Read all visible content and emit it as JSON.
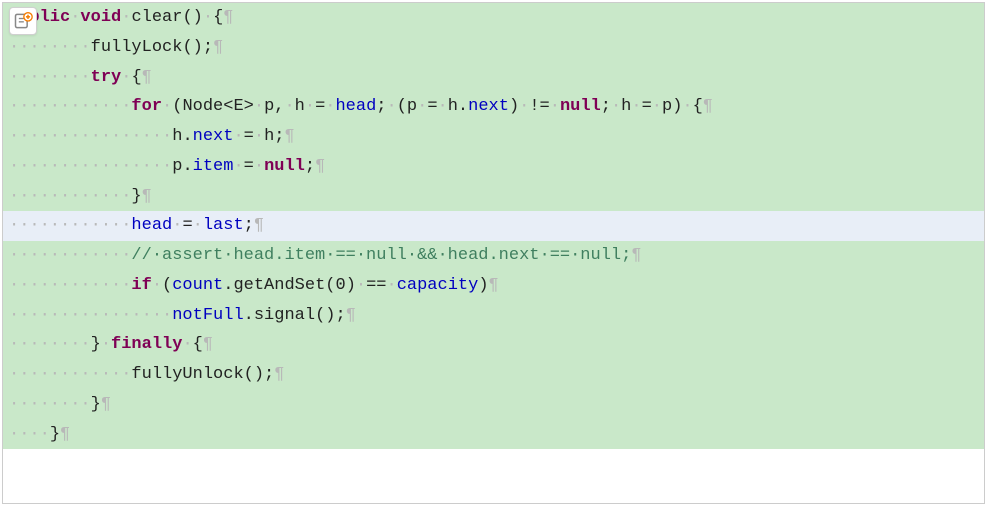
{
  "icon": {
    "name": "add-diff-icon"
  },
  "whitespace": {
    "dot": "·",
    "eol": "¶"
  },
  "code": {
    "lines": [
      {
        "bg": "added",
        "indentDots": 2,
        "tokens": [
          {
            "cls": "kw",
            "t": "blic"
          },
          {
            "cls": "ws",
            "t": "·"
          },
          {
            "cls": "kw",
            "t": "void"
          },
          {
            "cls": "ws",
            "t": "·"
          },
          {
            "cls": "method",
            "t": "clear"
          },
          {
            "cls": "punct",
            "t": "()"
          },
          {
            "cls": "ws",
            "t": "·"
          },
          {
            "cls": "punct",
            "t": "{"
          },
          {
            "cls": "eol",
            "t": "¶"
          }
        ]
      },
      {
        "bg": "added",
        "indentDots": 8,
        "tokens": [
          {
            "cls": "method",
            "t": "fullyLock"
          },
          {
            "cls": "punct",
            "t": "();"
          },
          {
            "cls": "eol",
            "t": "¶"
          }
        ]
      },
      {
        "bg": "added",
        "indentDots": 8,
        "tokens": [
          {
            "cls": "kw",
            "t": "try"
          },
          {
            "cls": "ws",
            "t": "·"
          },
          {
            "cls": "punct",
            "t": "{"
          },
          {
            "cls": "eol",
            "t": "¶"
          }
        ]
      },
      {
        "bg": "added",
        "indentDots": 12,
        "tokens": [
          {
            "cls": "kw",
            "t": "for"
          },
          {
            "cls": "ws",
            "t": "·"
          },
          {
            "cls": "punct",
            "t": "("
          },
          {
            "cls": "type",
            "t": "Node"
          },
          {
            "cls": "punct",
            "t": "<"
          },
          {
            "cls": "type",
            "t": "E"
          },
          {
            "cls": "punct",
            "t": ">"
          },
          {
            "cls": "ws",
            "t": "·"
          },
          {
            "cls": "ident",
            "t": "p"
          },
          {
            "cls": "punct",
            "t": ","
          },
          {
            "cls": "ws",
            "t": "·"
          },
          {
            "cls": "ident",
            "t": "h"
          },
          {
            "cls": "ws",
            "t": "·"
          },
          {
            "cls": "punct",
            "t": "="
          },
          {
            "cls": "ws",
            "t": "·"
          },
          {
            "cls": "field",
            "t": "head"
          },
          {
            "cls": "punct",
            "t": ";"
          },
          {
            "cls": "ws",
            "t": "·"
          },
          {
            "cls": "punct",
            "t": "("
          },
          {
            "cls": "ident",
            "t": "p"
          },
          {
            "cls": "ws",
            "t": "·"
          },
          {
            "cls": "punct",
            "t": "="
          },
          {
            "cls": "ws",
            "t": "·"
          },
          {
            "cls": "ident",
            "t": "h"
          },
          {
            "cls": "punct",
            "t": "."
          },
          {
            "cls": "field",
            "t": "next"
          },
          {
            "cls": "punct",
            "t": ")"
          },
          {
            "cls": "ws",
            "t": "·"
          },
          {
            "cls": "punct",
            "t": "!="
          },
          {
            "cls": "ws",
            "t": "·"
          },
          {
            "cls": "kw",
            "t": "null"
          },
          {
            "cls": "punct",
            "t": ";"
          },
          {
            "cls": "ws",
            "t": "·"
          },
          {
            "cls": "ident",
            "t": "h"
          },
          {
            "cls": "ws",
            "t": "·"
          },
          {
            "cls": "punct",
            "t": "="
          },
          {
            "cls": "ws",
            "t": "·"
          },
          {
            "cls": "ident",
            "t": "p"
          },
          {
            "cls": "punct",
            "t": ")"
          },
          {
            "cls": "ws",
            "t": "·"
          },
          {
            "cls": "punct",
            "t": "{"
          },
          {
            "cls": "eol",
            "t": "¶"
          }
        ]
      },
      {
        "bg": "added",
        "indentDots": 16,
        "tokens": [
          {
            "cls": "ident",
            "t": "h"
          },
          {
            "cls": "punct",
            "t": "."
          },
          {
            "cls": "field",
            "t": "next"
          },
          {
            "cls": "ws",
            "t": "·"
          },
          {
            "cls": "punct",
            "t": "="
          },
          {
            "cls": "ws",
            "t": "·"
          },
          {
            "cls": "ident",
            "t": "h"
          },
          {
            "cls": "punct",
            "t": ";"
          },
          {
            "cls": "eol",
            "t": "¶"
          }
        ]
      },
      {
        "bg": "added",
        "indentDots": 16,
        "tokens": [
          {
            "cls": "ident",
            "t": "p"
          },
          {
            "cls": "punct",
            "t": "."
          },
          {
            "cls": "field",
            "t": "item"
          },
          {
            "cls": "ws",
            "t": "·"
          },
          {
            "cls": "punct",
            "t": "="
          },
          {
            "cls": "ws",
            "t": "·"
          },
          {
            "cls": "kw",
            "t": "null"
          },
          {
            "cls": "punct",
            "t": ";"
          },
          {
            "cls": "eol",
            "t": "¶"
          }
        ]
      },
      {
        "bg": "added",
        "indentDots": 12,
        "tokens": [
          {
            "cls": "punct",
            "t": "}"
          },
          {
            "cls": "eol",
            "t": "¶"
          }
        ]
      },
      {
        "bg": "highlight",
        "indentDots": 12,
        "tokens": [
          {
            "cls": "field",
            "t": "head"
          },
          {
            "cls": "ws",
            "t": "·"
          },
          {
            "cls": "punct",
            "t": "="
          },
          {
            "cls": "ws",
            "t": "·"
          },
          {
            "cls": "field",
            "t": "last"
          },
          {
            "cls": "punct",
            "t": ";"
          },
          {
            "cls": "eol",
            "t": "¶"
          }
        ]
      },
      {
        "bg": "added",
        "indentDots": 12,
        "tokens": [
          {
            "cls": "comment",
            "t": "//·assert·head.item·==·null·&&·head.next·==·null;"
          },
          {
            "cls": "eol",
            "t": "¶"
          }
        ]
      },
      {
        "bg": "added",
        "indentDots": 12,
        "tokens": [
          {
            "cls": "kw",
            "t": "if"
          },
          {
            "cls": "ws",
            "t": "·"
          },
          {
            "cls": "punct",
            "t": "("
          },
          {
            "cls": "field",
            "t": "count"
          },
          {
            "cls": "punct",
            "t": "."
          },
          {
            "cls": "method",
            "t": "getAndSet"
          },
          {
            "cls": "punct",
            "t": "("
          },
          {
            "cls": "num",
            "t": "0"
          },
          {
            "cls": "punct",
            "t": ")"
          },
          {
            "cls": "ws",
            "t": "·"
          },
          {
            "cls": "punct",
            "t": "=="
          },
          {
            "cls": "ws",
            "t": "·"
          },
          {
            "cls": "field",
            "t": "capacity"
          },
          {
            "cls": "punct",
            "t": ")"
          },
          {
            "cls": "eol",
            "t": "¶"
          }
        ]
      },
      {
        "bg": "added",
        "indentDots": 16,
        "tokens": [
          {
            "cls": "field",
            "t": "notFull"
          },
          {
            "cls": "punct",
            "t": "."
          },
          {
            "cls": "method",
            "t": "signal"
          },
          {
            "cls": "punct",
            "t": "();"
          },
          {
            "cls": "eol",
            "t": "¶"
          }
        ]
      },
      {
        "bg": "added",
        "indentDots": 8,
        "tokens": [
          {
            "cls": "punct",
            "t": "}"
          },
          {
            "cls": "ws",
            "t": "·"
          },
          {
            "cls": "kw",
            "t": "finally"
          },
          {
            "cls": "ws",
            "t": "·"
          },
          {
            "cls": "punct",
            "t": "{"
          },
          {
            "cls": "eol",
            "t": "¶"
          }
        ]
      },
      {
        "bg": "added",
        "indentDots": 12,
        "tokens": [
          {
            "cls": "method",
            "t": "fullyUnlock"
          },
          {
            "cls": "punct",
            "t": "();"
          },
          {
            "cls": "eol",
            "t": "¶"
          }
        ]
      },
      {
        "bg": "added",
        "indentDots": 8,
        "tokens": [
          {
            "cls": "punct",
            "t": "}"
          },
          {
            "cls": "eol",
            "t": "¶"
          }
        ]
      },
      {
        "bg": "added",
        "indentDots": 4,
        "tokens": [
          {
            "cls": "punct",
            "t": "}"
          },
          {
            "cls": "eol",
            "t": "¶"
          }
        ]
      }
    ]
  }
}
